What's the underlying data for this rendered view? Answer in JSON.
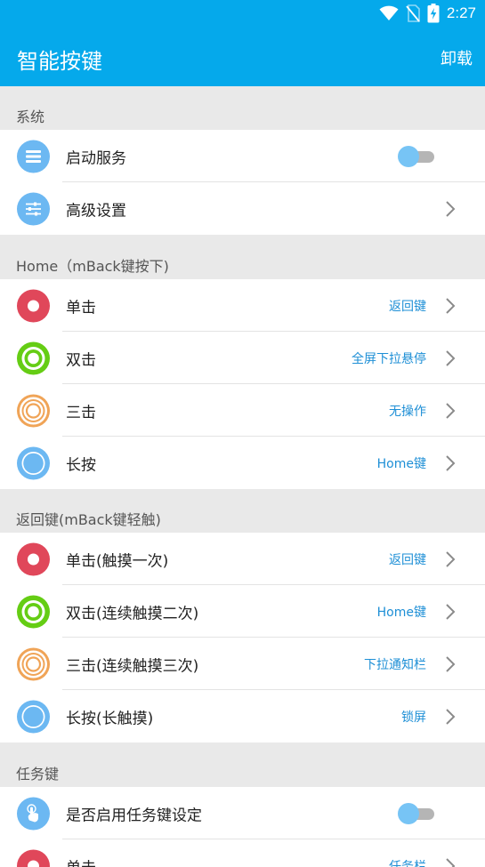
{
  "status_bar": {
    "time": "2:27",
    "icons": [
      "wifi-icon",
      "no-sim-icon",
      "battery-charging-icon"
    ]
  },
  "app_bar": {
    "title": "智能按键",
    "action_label": "卸载"
  },
  "colors": {
    "primary": "#05a9eb",
    "value_text": "#1e8fd6",
    "red": "#e0475a",
    "green": "#65cd14",
    "orange": "#f0a457",
    "blue": "#6cb8f2"
  },
  "sections": [
    {
      "header": "系统",
      "rows": [
        {
          "label": "启动服务",
          "icon": "service-list-icon",
          "type": "toggle",
          "enabled": false
        },
        {
          "label": "高级设置",
          "icon": "sliders-icon",
          "type": "nav"
        }
      ]
    },
    {
      "header": "Home（mBack键按下)",
      "rows": [
        {
          "label": "单击",
          "icon": "single-tap-icon",
          "value": "返回键"
        },
        {
          "label": "双击",
          "icon": "double-tap-icon",
          "value": "全屏下拉悬停"
        },
        {
          "label": "三击",
          "icon": "triple-tap-icon",
          "value": "无操作"
        },
        {
          "label": "长按",
          "icon": "long-press-icon",
          "value": "Home键"
        }
      ]
    },
    {
      "header": "返回键(mBack键轻触)",
      "rows": [
        {
          "label": "单击(触摸一次)",
          "icon": "single-tap-icon",
          "value": "返回键"
        },
        {
          "label": "双击(连续触摸二次)",
          "icon": "double-tap-icon",
          "value": "Home键"
        },
        {
          "label": "三击(连续触摸三次)",
          "icon": "triple-tap-icon",
          "value": "下拉通知栏"
        },
        {
          "label": "长按(长触摸)",
          "icon": "long-press-icon",
          "value": "锁屏"
        }
      ]
    },
    {
      "header": "任务键",
      "rows": [
        {
          "label": "是否启用任务键设定",
          "icon": "touch-hand-icon",
          "type": "toggle",
          "enabled": false
        },
        {
          "label": "单击",
          "icon": "single-tap-icon",
          "value": "任务栏"
        }
      ]
    }
  ]
}
